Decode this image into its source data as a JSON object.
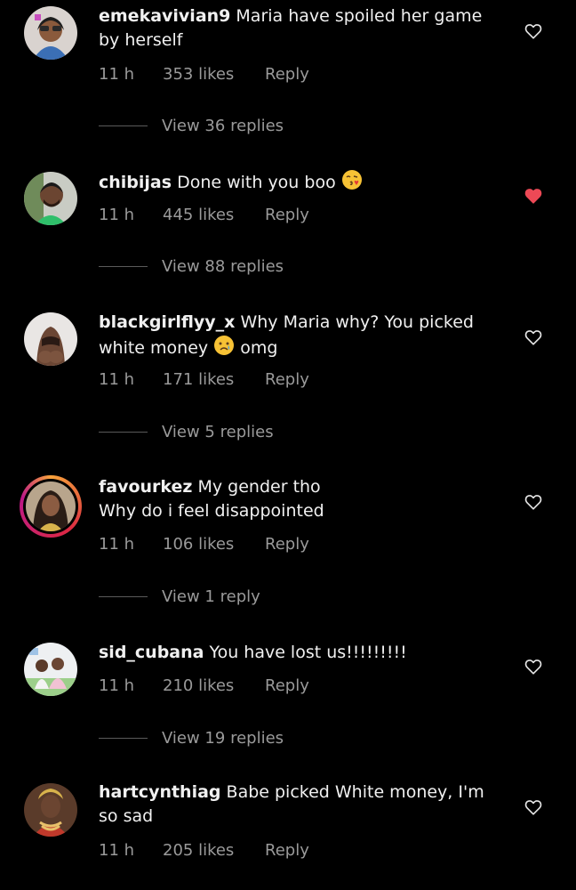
{
  "comments": [
    {
      "username": "emekavivian9",
      "text": "Maria have spoiled her game by herself",
      "time": "11 h",
      "likes": "353 likes",
      "reply": "Reply",
      "view_replies": "View 36 replies",
      "liked": false
    },
    {
      "username": "chibijas",
      "text": "Done with you boo",
      "emoji": "blowing-kiss-emoji",
      "time": "11 h",
      "likes": "445 likes",
      "reply": "Reply",
      "view_replies": "View 88 replies",
      "liked": true
    },
    {
      "username": "blackgirlflyy_x",
      "text_before": "Why Maria why? You picked white money",
      "emoji": "crying-emoji",
      "text_after": "omg",
      "time": "11 h",
      "likes": "171 likes",
      "reply": "Reply",
      "view_replies": "View 5 replies",
      "liked": false
    },
    {
      "username": "favourkez",
      "text_line1": "My gender tho",
      "text_line2": "Why do i feel disappointed",
      "time": "11 h",
      "likes": "106 likes",
      "reply": "Reply",
      "view_replies": "View 1 reply",
      "liked": false
    },
    {
      "username": "sid_cubana",
      "text": "You have lost us!!!!!!!!!",
      "time": "11 h",
      "likes": "210 likes",
      "reply": "Reply",
      "view_replies": "View 19 replies",
      "liked": false
    },
    {
      "username": "hartcynthiag",
      "text": "Babe picked White money, I'm so sad",
      "time": "11 h",
      "likes": "205 likes",
      "reply": "Reply",
      "liked": false
    }
  ],
  "colors": {
    "background": "#000000",
    "text": "#f0f0f0",
    "meta": "#9a9a9a",
    "heart_liked": "#ed4956",
    "heart_outline": "#e6e6e6"
  }
}
